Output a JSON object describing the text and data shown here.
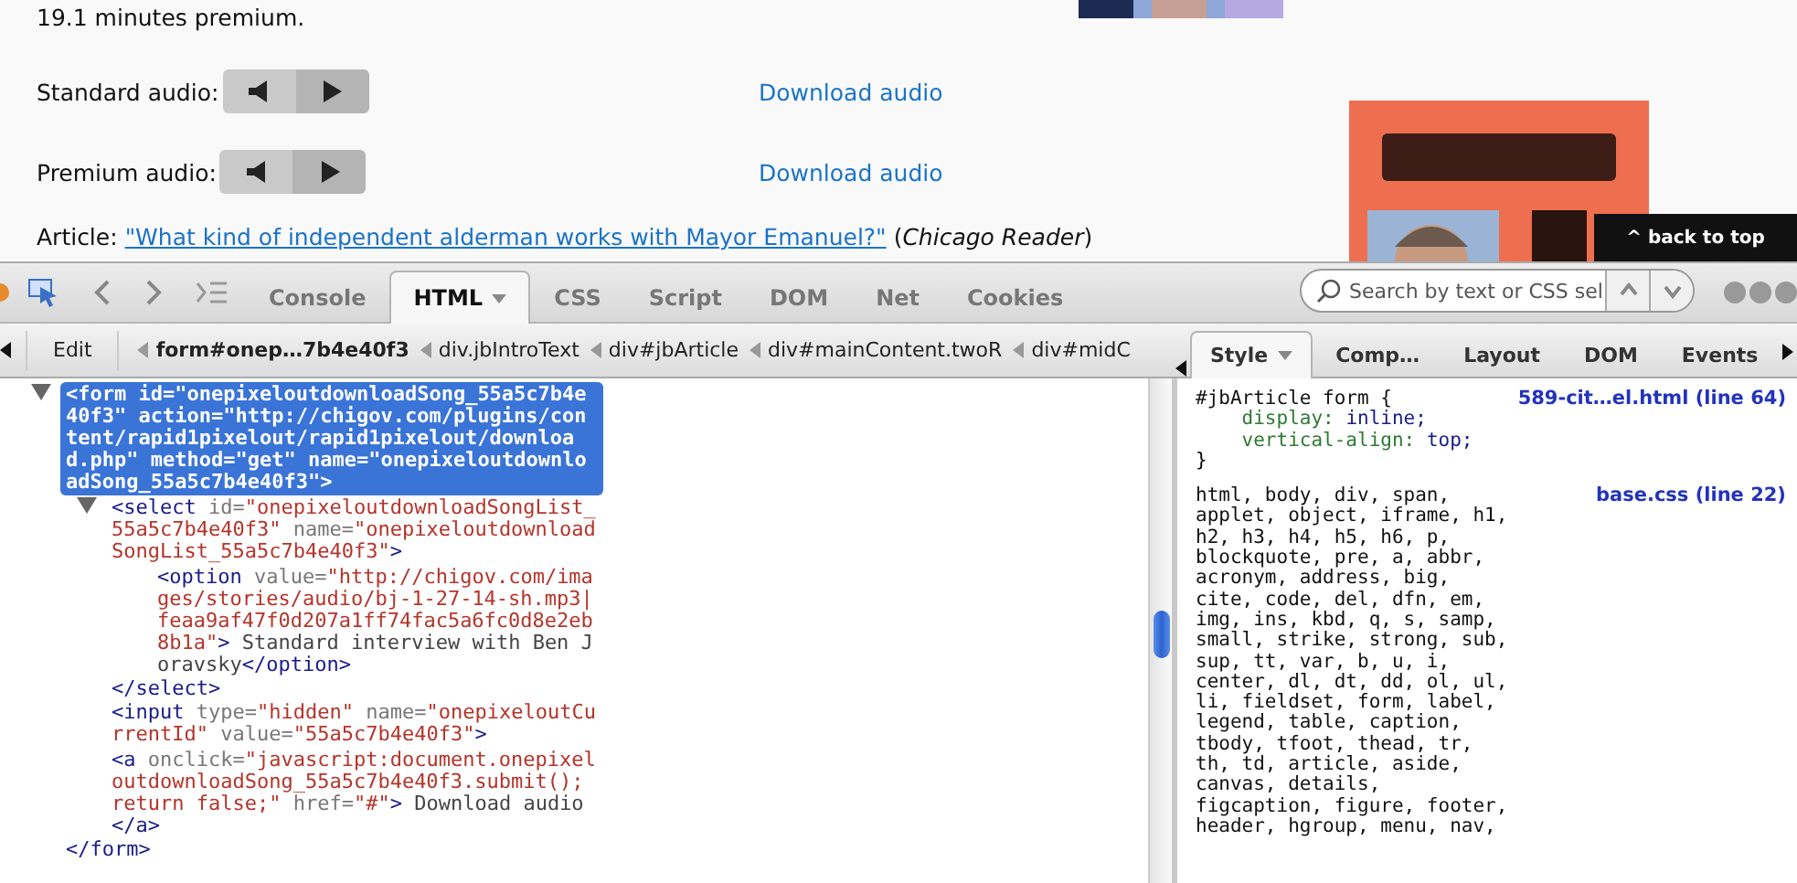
{
  "page": {
    "intro": "19.1 minutes premium.",
    "audio_rows": [
      {
        "label": "Standard audio:",
        "link": "Download audio"
      },
      {
        "label": "Premium audio:",
        "link": "Download audio"
      }
    ],
    "article": {
      "label": "Article:",
      "link": "\"What kind of independent alderman works with Mayor Emanuel?\"",
      "source": "(*Chicago Reader*)"
    },
    "back_to_top": "^ back to top"
  },
  "devtools": {
    "tabs": [
      {
        "label": "Console",
        "selected": false
      },
      {
        "label": "HTML",
        "selected": true
      },
      {
        "label": "CSS",
        "selected": false
      },
      {
        "label": "Script",
        "selected": false
      },
      {
        "label": "DOM",
        "selected": false
      },
      {
        "label": "Net",
        "selected": false
      },
      {
        "label": "Cookies",
        "selected": false
      }
    ],
    "search": {
      "placeholder": "Search by text or CSS sel"
    },
    "edit_button": "Edit",
    "breadcrumbs": [
      {
        "label": "form#onep…7b4e40f3",
        "selected": true
      },
      {
        "label": "div.jbIntroText",
        "selected": false
      },
      {
        "label": "div#jbArticle",
        "selected": false
      },
      {
        "label": "div#mainContent.twoR",
        "selected": false
      },
      {
        "label": "div#midC",
        "selected": false
      }
    ],
    "side_tabs": [
      {
        "label": "Style",
        "selected": true
      },
      {
        "label": "Comp…",
        "selected": false
      },
      {
        "label": "Layout",
        "selected": false
      },
      {
        "label": "DOM",
        "selected": false
      },
      {
        "label": "Events",
        "selected": false
      }
    ],
    "html_tree": [
      {
        "tag": "<form",
        "attrs": [
          {
            "name": "id=",
            "value": "\"onepixeloutdownloadSong_55a5c7b4e40f3\""
          },
          {
            "name": "action=",
            "value": "\"http://chigov.com/plugins/content/rapid1pixelout/rapid1pixelout/download.php\""
          },
          {
            "name": "method=",
            "value": "\"get\""
          },
          {
            "name": "name=",
            "value": "\"onepixeloutdownloadSong_55a5c7b4e40f3\""
          }
        ],
        "end": ">",
        "selected": true,
        "expanded": true,
        "close": "</form>",
        "children": [
          {
            "tag": "<select",
            "attrs": [
              {
                "name": "id=",
                "value": "\"onepixeloutdownloadSongList_55a5c7b4e40f3\""
              },
              {
                "name": "name=",
                "value": "\"onepixeloutdownloadSongList_55a5c7b4e40f3\""
              }
            ],
            "end": ">",
            "selected": false,
            "expanded": true,
            "close": "</select>",
            "children": [
              {
                "tag": "<option",
                "attrs": [
                  {
                    "name": "value=",
                    "value": "\"http://chigov.com/images/stories/audio/bj-1-27-14-sh.mp3|feaa9af47f0d207a1ff74fac5a6fc0d8e2eb8b1a\""
                  }
                ],
                "end": ">",
                "selected": false,
                "text": "Standard interview with Ben Joravsky",
                "close": "</option>"
              }
            ]
          },
          {
            "tag": "<input",
            "attrs": [
              {
                "name": "type=",
                "value": "\"hidden\""
              },
              {
                "name": "name=",
                "value": "\"onepixeloutCurrentId\""
              },
              {
                "name": "value=",
                "value": "\"55a5c7b4e40f3\""
              }
            ],
            "end": ">",
            "selected": false
          },
          {
            "tag": "<a",
            "attrs": [
              {
                "name": "onclick=",
                "value": "\"javascript:document.onepixeloutdownloadSong_55a5c7b4e40f3.submit(); return false;\""
              },
              {
                "name": "href=",
                "value": "\"#\""
              }
            ],
            "end": ">",
            "selected": false,
            "text": "Download audio",
            "close": "</a>"
          }
        ]
      }
    ],
    "style_rules": [
      {
        "selector": "#jbArticle form {",
        "source": "589-cit…el.html (line 64)",
        "properties": [
          {
            "name": "display:",
            "value": "inline;"
          },
          {
            "name": "vertical-align:",
            "value": "top;"
          }
        ],
        "close": "}"
      },
      {
        "selector": "html, body, div, span, applet, object, iframe, h1, h2, h3, h4, h5, h6, p, blockquote, pre, a, abbr, acronym, address, big, cite, code, del, dfn, em, img, ins, kbd, q, s, samp, small, strike, strong, sub, sup, tt, var, b, u, i, center, dl, dt, dd, ol, ul, li, fieldset, form, label, legend, table, caption, tbody, tfoot, thead, tr, th, td, article, aside, canvas, details, figcaption, figure, footer, header, hgroup, menu, nav,",
        "source": "base.css (line 22)"
      }
    ]
  }
}
